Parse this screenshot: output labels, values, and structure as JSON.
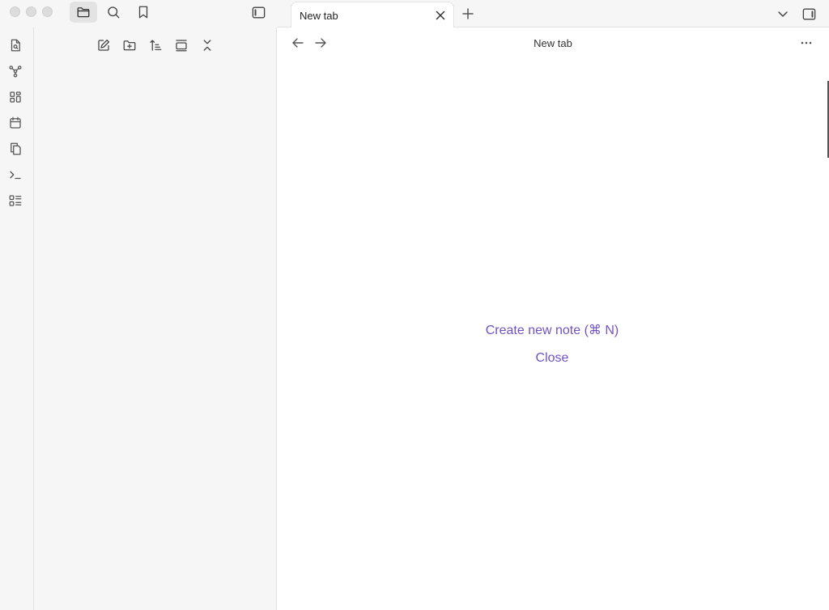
{
  "app": {
    "sidebar_tabs": [
      {
        "name": "files",
        "icon": "folder-icon",
        "active": true
      },
      {
        "name": "search",
        "icon": "search-icon",
        "active": false
      },
      {
        "name": "bookmarks",
        "icon": "bookmark-icon",
        "active": false
      }
    ],
    "ribbon": [
      {
        "icon": "quick-switcher-icon"
      },
      {
        "icon": "graph-view-icon"
      },
      {
        "icon": "canvas-icon"
      },
      {
        "icon": "daily-note-icon"
      },
      {
        "icon": "templates-icon"
      },
      {
        "icon": "command-palette-icon"
      },
      {
        "icon": "outline-icon"
      }
    ],
    "explorer_tools": [
      {
        "icon": "new-note-icon"
      },
      {
        "icon": "new-folder-icon"
      },
      {
        "icon": "sort-icon"
      },
      {
        "icon": "auto-reveal-icon"
      },
      {
        "icon": "collapse-all-icon"
      }
    ]
  },
  "tabbar": {
    "active_tab": {
      "title": "New tab"
    }
  },
  "view": {
    "title": "New tab",
    "create_note_label": "Create new note (⌘ N)",
    "close_label": "Close"
  },
  "colors": {
    "accent": "#7152c4",
    "chrome_bg": "#f6f6f6",
    "content_bg": "#ffffff"
  }
}
